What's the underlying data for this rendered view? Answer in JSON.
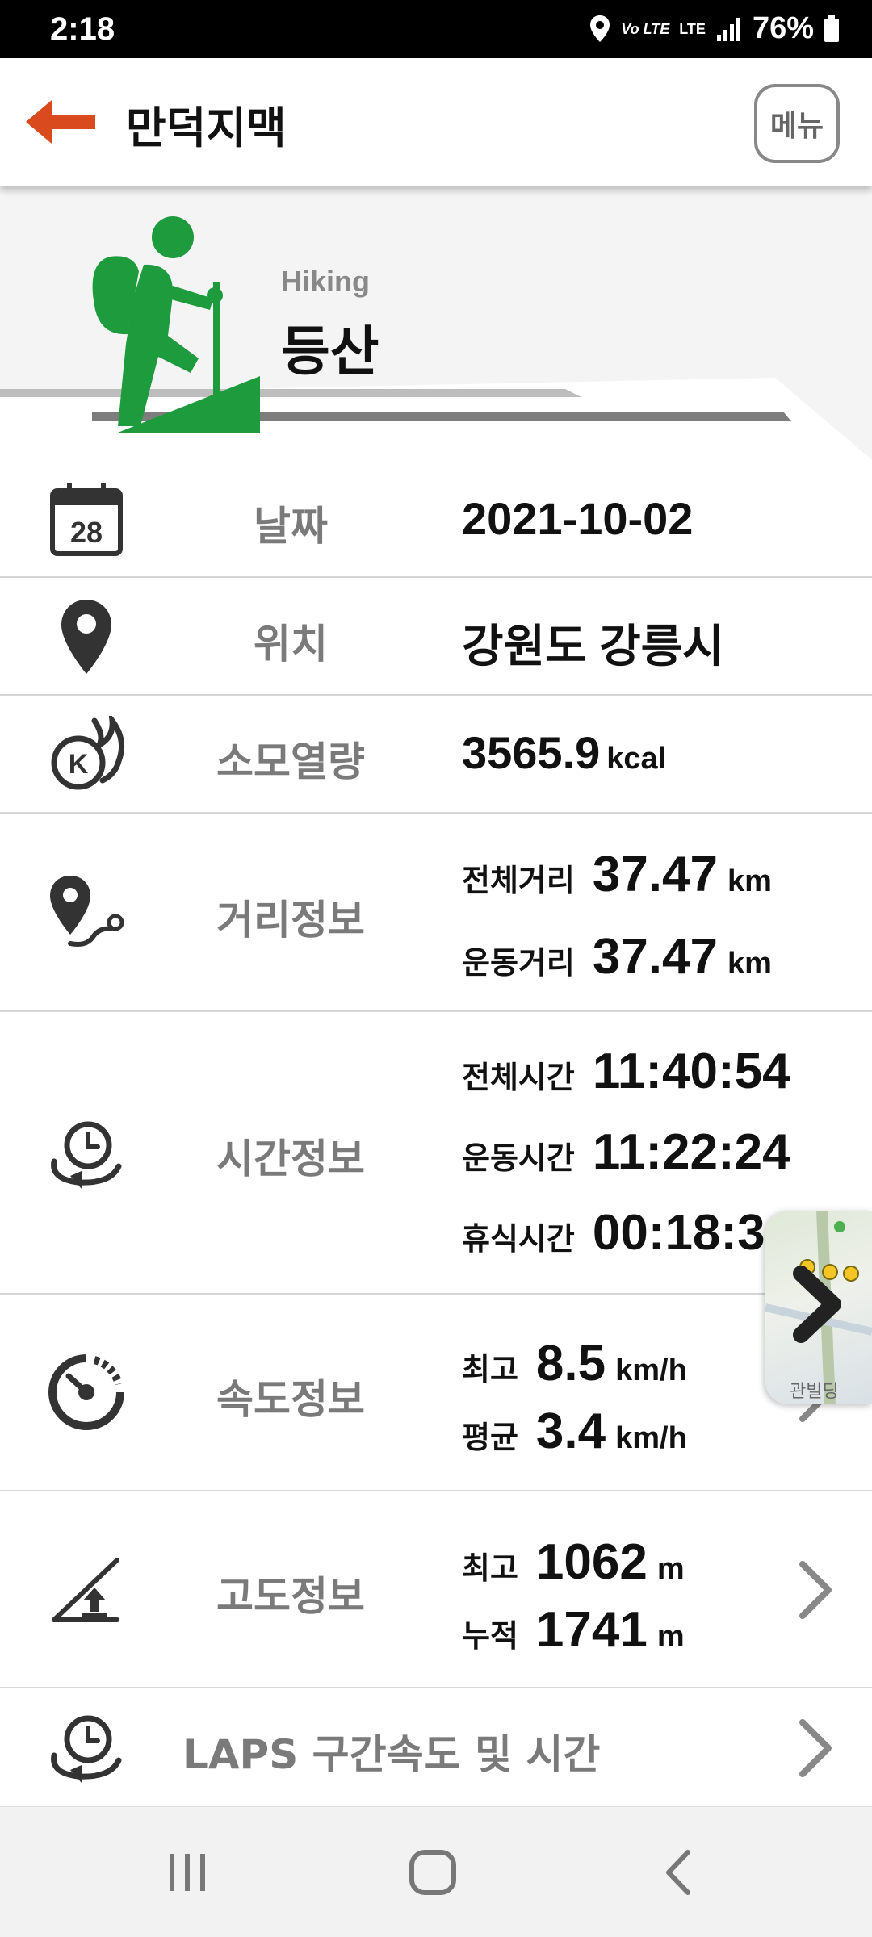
{
  "status_bar": {
    "time": "2:18",
    "volte": "Vo LTE",
    "lte": "LTE",
    "battery": "76%"
  },
  "header": {
    "title": "만덕지맥",
    "menu_label": "메뉴"
  },
  "hero": {
    "subtitle": "Hiking",
    "title": "등산",
    "icon": "hiker-icon",
    "accent_color": "#1e9b3c"
  },
  "rows": {
    "date": {
      "icon": "calendar-icon",
      "icon_text": "28",
      "label": "날짜",
      "value": "2021-10-02"
    },
    "location": {
      "icon": "location-pin-icon",
      "label": "위치",
      "value": "강원도 강릉시"
    },
    "calories": {
      "icon": "calorie-flame-icon",
      "icon_text": "K",
      "label": "소모열량",
      "value": "3565.9",
      "unit": "kcal"
    },
    "distance": {
      "icon": "route-pin-icon",
      "label": "거리정보",
      "total_key": "전체거리",
      "total_value": "37.47",
      "total_unit": "km",
      "exercise_key": "운동거리",
      "exercise_value": "37.47",
      "exercise_unit": "km"
    },
    "time": {
      "icon": "clock-cycle-icon",
      "label": "시간정보",
      "total_key": "전체시간",
      "total_value": "11:40:54",
      "exercise_key": "운동시간",
      "exercise_value": "11:22:24",
      "rest_key": "휴식시간",
      "rest_value": "00:18:3"
    },
    "speed": {
      "icon": "speedometer-icon",
      "label": "속도정보",
      "max_key": "최고",
      "max_value": "8.5",
      "max_unit": "km/h",
      "avg_key": "평균",
      "avg_value": "3.4",
      "avg_unit": "km/h"
    },
    "altitude": {
      "icon": "altitude-slope-icon",
      "label": "고도정보",
      "max_key": "최고",
      "max_value": "1062",
      "max_unit": "m",
      "cum_key": "누적",
      "cum_value": "1741",
      "cum_unit": "m"
    },
    "laps": {
      "icon": "clock-cycle-icon",
      "label": "LAPS 구간속도 및 시간"
    }
  },
  "map_thumb": {
    "icon": "map-thumbnail-icon",
    "label": "관빌딩"
  },
  "nav": {
    "recents": "recents-icon",
    "home": "home-icon",
    "back": "back-icon"
  },
  "colors": {
    "back_arrow": "#d94a1e",
    "label_gray": "#7a7a7a"
  }
}
